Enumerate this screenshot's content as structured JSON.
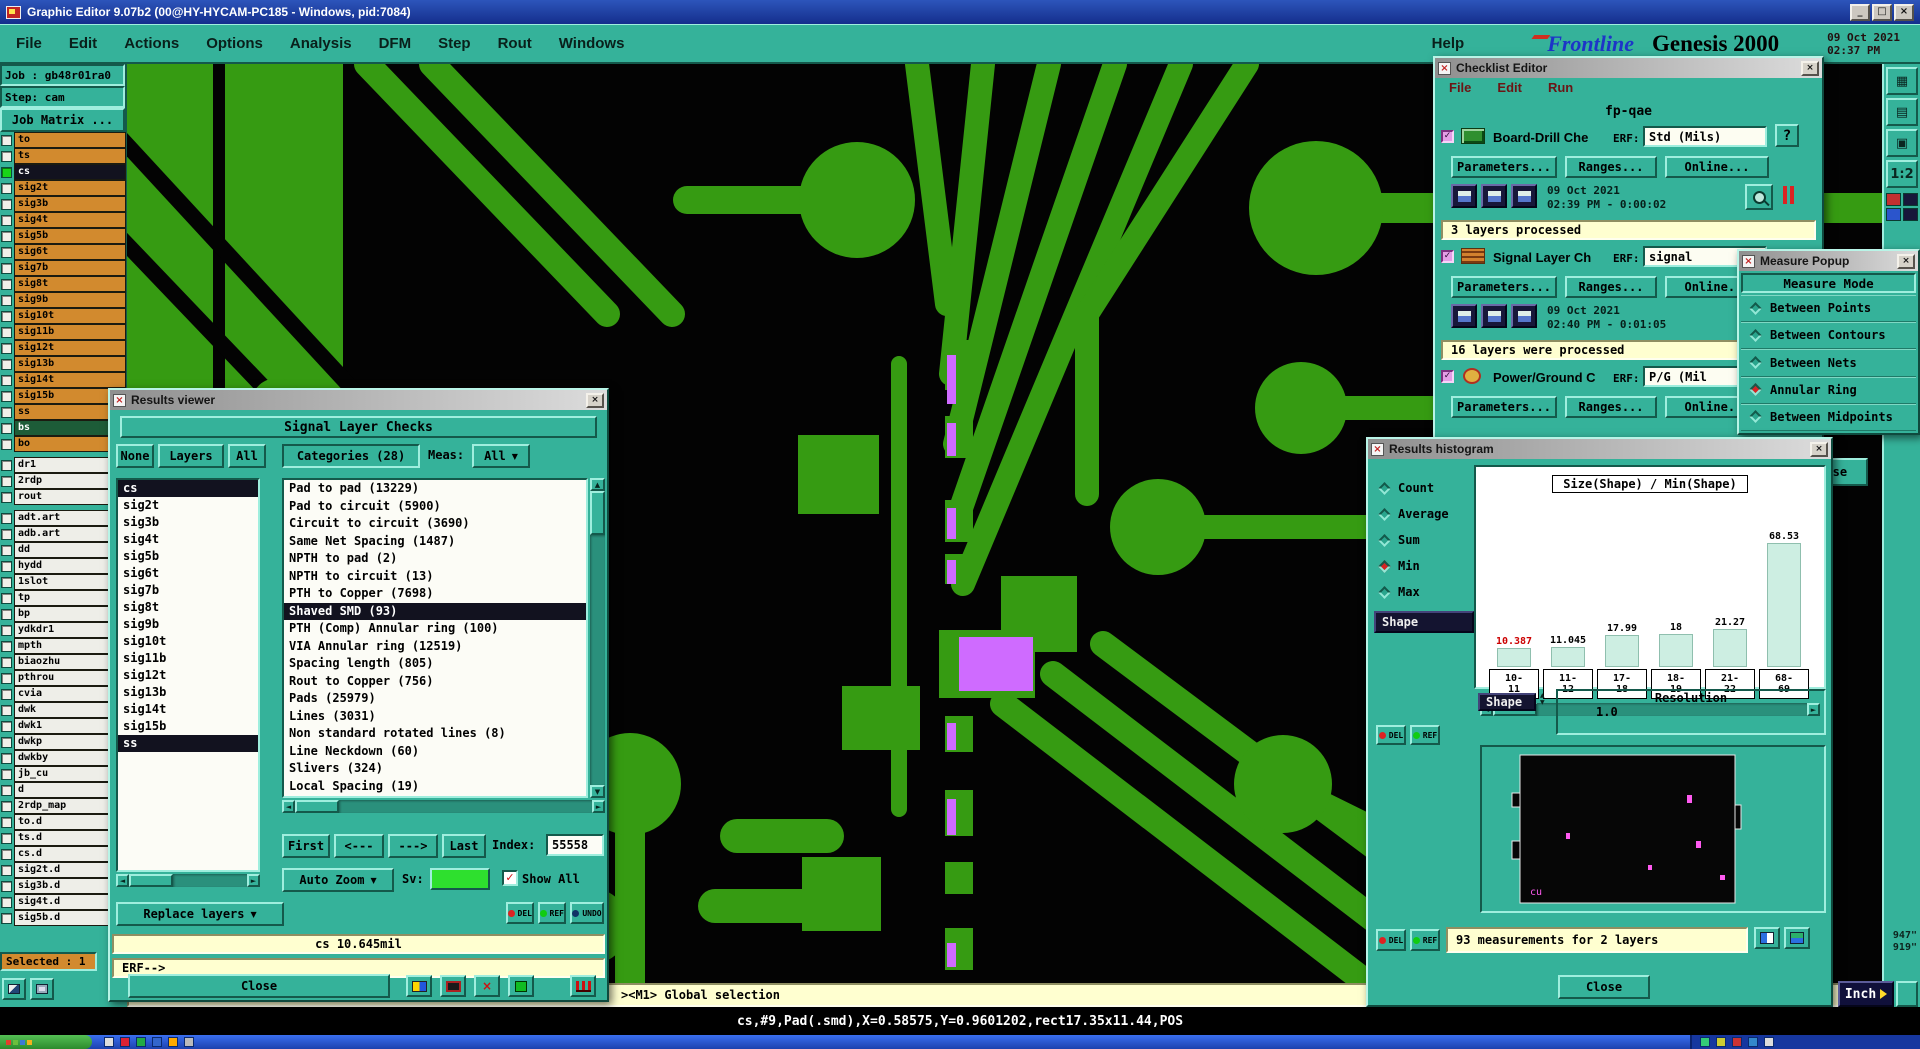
{
  "colors": {
    "ui_teal": "#35b29a",
    "layer_orange": "#d28a2e",
    "selected_row": "#12121f",
    "bs_row_green": "#1d5c38",
    "pcb_green": "#369b12",
    "highlight_violet": "#cf6bff",
    "status_yellow": "#ffffd0",
    "alert_red": "#cc2222",
    "histogram_bar": "#cdeee2",
    "sv_swatch_green": "#2ee02e"
  },
  "icons": {
    "minimize": "_",
    "maximize": "□",
    "close": "×",
    "dropdown": "▼",
    "check": "✓",
    "left": "◄",
    "right": "►",
    "up": "▲",
    "down": "▼"
  },
  "titlebar": {
    "title": "Graphic Editor 9.07b2 (00@HY-HYCAM-PC185 - Windows, pid:7084)"
  },
  "menubar": {
    "items": [
      "File",
      "Edit",
      "Actions",
      "Options",
      "Analysis",
      "DFM",
      "Step",
      "Rout",
      "Windows"
    ],
    "help": "Help",
    "logo": "Frontline",
    "product": "Genesis 2000",
    "date": "09 Oct 2021",
    "time": "02:37 PM"
  },
  "left_panel": {
    "job": "Job : gb48r01ra0",
    "step": "Step: cam",
    "matrix_button": "Job Matrix ...",
    "selected": "Selected : 1",
    "layers": [
      {
        "name": "to",
        "style": "orange"
      },
      {
        "name": "ts",
        "style": "orange"
      },
      {
        "name": "cs",
        "style": "seldark",
        "active": true
      },
      {
        "name": "sig2t",
        "style": "orange"
      },
      {
        "name": "sig3b",
        "style": "orange"
      },
      {
        "name": "sig4t",
        "style": "orange"
      },
      {
        "name": "sig5b",
        "style": "orange"
      },
      {
        "name": "sig6t",
        "style": "orange"
      },
      {
        "name": "sig7b",
        "style": "orange"
      },
      {
        "name": "sig8t",
        "style": "orange"
      },
      {
        "name": "sig9b",
        "style": "orange"
      },
      {
        "name": "sig10t",
        "style": "orange"
      },
      {
        "name": "sig11b",
        "style": "orange"
      },
      {
        "name": "sig12t",
        "style": "orange"
      },
      {
        "name": "sig13b",
        "style": "orange"
      },
      {
        "name": "sig14t",
        "style": "orange"
      },
      {
        "name": "sig15b",
        "style": "orange"
      },
      {
        "name": "ss",
        "style": "orange"
      },
      {
        "name": "bs",
        "style": "bsgreen"
      },
      {
        "name": "bo",
        "style": "orange"
      },
      {
        "separator": true
      },
      {
        "name": "dr1",
        "style": "white"
      },
      {
        "name": "2rdp",
        "style": "white"
      },
      {
        "name": "rout",
        "style": "white"
      },
      {
        "separator": true
      },
      {
        "name": "adt.art",
        "style": "white"
      },
      {
        "name": "adb.art",
        "style": "white"
      },
      {
        "name": "dd",
        "style": "white"
      },
      {
        "name": "hydd",
        "style": "white"
      },
      {
        "name": "1slot",
        "style": "white"
      },
      {
        "name": "tp",
        "style": "white"
      },
      {
        "name": "bp",
        "style": "white"
      },
      {
        "name": "ydkdr1",
        "style": "white"
      },
      {
        "name": "mpth",
        "style": "white"
      },
      {
        "name": "biaozhu",
        "style": "white"
      },
      {
        "name": "pthrou",
        "style": "white"
      },
      {
        "name": "cvia",
        "style": "white"
      },
      {
        "name": "dwk",
        "style": "white"
      },
      {
        "name": "dwk1",
        "style": "white"
      },
      {
        "name": "dwkp",
        "style": "white"
      },
      {
        "name": "dwkby",
        "style": "white"
      },
      {
        "name": "jb_cu",
        "style": "white"
      },
      {
        "name": "d",
        "style": "white"
      },
      {
        "name": "2rdp_map",
        "style": "white"
      },
      {
        "name": "to.d",
        "style": "white"
      },
      {
        "name": "ts.d",
        "style": "white"
      },
      {
        "name": "cs.d",
        "style": "white"
      },
      {
        "name": "sig2t.d",
        "style": "white"
      },
      {
        "name": "sig3b.d",
        "style": "white"
      },
      {
        "name": "sig4t.d",
        "style": "white"
      },
      {
        "name": "sig5b.d",
        "style": "white"
      }
    ]
  },
  "results_viewer": {
    "title": "Results viewer",
    "header": "Signal Layer Checks",
    "filter_buttons": [
      "None",
      "Layers",
      "All"
    ],
    "categories_label": "Categories (28)",
    "meas_label": "Meas:",
    "meas_value": "All",
    "layers": [
      {
        "name": "cs",
        "selected": true
      },
      {
        "name": "sig2t"
      },
      {
        "name": "sig3b"
      },
      {
        "name": "sig4t"
      },
      {
        "name": "sig5b"
      },
      {
        "name": "sig6t"
      },
      {
        "name": "sig7b"
      },
      {
        "name": "sig8t"
      },
      {
        "name": "sig9b"
      },
      {
        "name": "sig10t"
      },
      {
        "name": "sig11b"
      },
      {
        "name": "sig12t"
      },
      {
        "name": "sig13b"
      },
      {
        "name": "sig14t"
      },
      {
        "name": "sig15b"
      },
      {
        "name": "ss",
        "selected": true
      }
    ],
    "categories": [
      {
        "label": "Pad to pad (13229)"
      },
      {
        "label": "Pad to circuit (5900)"
      },
      {
        "label": "Circuit to circuit (3690)"
      },
      {
        "label": "Same Net Spacing (1487)"
      },
      {
        "label": "NPTH to pad (2)"
      },
      {
        "label": "NPTH to circuit (13)"
      },
      {
        "label": "PTH to Copper (7698)"
      },
      {
        "label": "Shaved SMD (93)",
        "selected": true
      },
      {
        "label": "PTH (Comp) Annular ring (100)"
      },
      {
        "label": "VIA Annular ring (12519)"
      },
      {
        "label": "Spacing length (805)"
      },
      {
        "label": "Rout to Copper (756)"
      },
      {
        "label": "Pads (25979)"
      },
      {
        "label": "Lines (3031)"
      },
      {
        "label": "Non standard rotated lines (8)"
      },
      {
        "label": "Line Neckdown (60)"
      },
      {
        "label": "Slivers (324)"
      },
      {
        "label": "Local Spacing (19)"
      }
    ],
    "nav": {
      "first": "First",
      "prev": "<---",
      "next": "--->",
      "last": "Last",
      "index_label": "Index:",
      "index_value": "55558"
    },
    "auto_zoom": "Auto Zoom",
    "sv_label": "Sv:",
    "show_all": "Show All",
    "replace_layers": "Replace layers",
    "del": "DEL",
    "ref": "REF",
    "undo": "UNDO",
    "measure_readout": "cs 10.645mil",
    "erf_prompt": "ERF-->",
    "close": "Close"
  },
  "checklist_editor": {
    "title": "Checklist Editor",
    "menu": [
      "File",
      "Edit",
      "Run"
    ],
    "name": "fp-qae",
    "partial_close": "Close",
    "actions": [
      {
        "label": "Board-Drill Che",
        "erf_label": "ERF:",
        "erf_value": "Std (Mils)",
        "help": "?",
        "buttons": [
          "Parameters...",
          "Ranges...",
          "Online..."
        ],
        "timestamp": "09 Oct 2021",
        "duration": "02:39 PM - 0:00:02",
        "status": "3 layers processed"
      },
      {
        "label": "Signal Layer Ch",
        "erf_label": "ERF:",
        "erf_value": "signal",
        "buttons": [
          "Parameters...",
          "Ranges...",
          "Online..."
        ],
        "timestamp": "09 Oct 2021",
        "duration": "02:40 PM - 0:01:05",
        "status": "16 layers were processed"
      },
      {
        "label": "Power/Ground C",
        "erf_label": "ERF:",
        "erf_value": "P/G (Mil",
        "buttons": [
          "Parameters...",
          "Ranges...",
          "Online..."
        ]
      }
    ]
  },
  "measure_popup": {
    "title": "Measure Popup",
    "header": "Measure Mode",
    "options": [
      {
        "label": "Between Points"
      },
      {
        "label": "Between Contours"
      },
      {
        "label": "Between Nets"
      },
      {
        "label": "Annular Ring",
        "selected": true
      },
      {
        "label": "Between Midpoints"
      }
    ]
  },
  "results_histogram": {
    "title": "Results histogram",
    "stats": [
      {
        "label": "Count"
      },
      {
        "label": "Average"
      },
      {
        "label": "Sum"
      },
      {
        "label": "Min",
        "selected": true
      },
      {
        "label": "Max"
      }
    ],
    "shape_button": "Shape",
    "chart_data": {
      "type": "bar",
      "title": "Size(Shape) / Min(Shape)",
      "categories": [
        "10-11",
        "11-12",
        "17-18",
        "18-19",
        "21-22",
        "68-69"
      ],
      "values": [
        10.387,
        11.045,
        17.99,
        18,
        21.27,
        68.53
      ],
      "value_labels": [
        "10.387",
        "11.045",
        "17.99",
        "18",
        "21.27",
        "68.53"
      ],
      "highlight_value_index": 0,
      "xlabel": "",
      "ylabel": "",
      "ylim": [
        0,
        72
      ],
      "legend": false,
      "grid": false
    },
    "shape_label": "Shape",
    "resolution_label": "Resolution",
    "resolution_value": "1.0",
    "minimap_label": "cu",
    "del": "DEL",
    "ref": "REF",
    "footer": "93 measurements for 2 layers",
    "close": "Close"
  },
  "right_toolbar": {
    "scale_button": "1:2",
    "coord_x": "947\"",
    "coord_y": "919\"",
    "unit_button": "Inch"
  },
  "status": {
    "selection": "><M1> Global selection",
    "coords": "cs,#9,Pad(.smd),X=0.58575,Y=0.9601202,rect17.35x11.44,POS"
  }
}
